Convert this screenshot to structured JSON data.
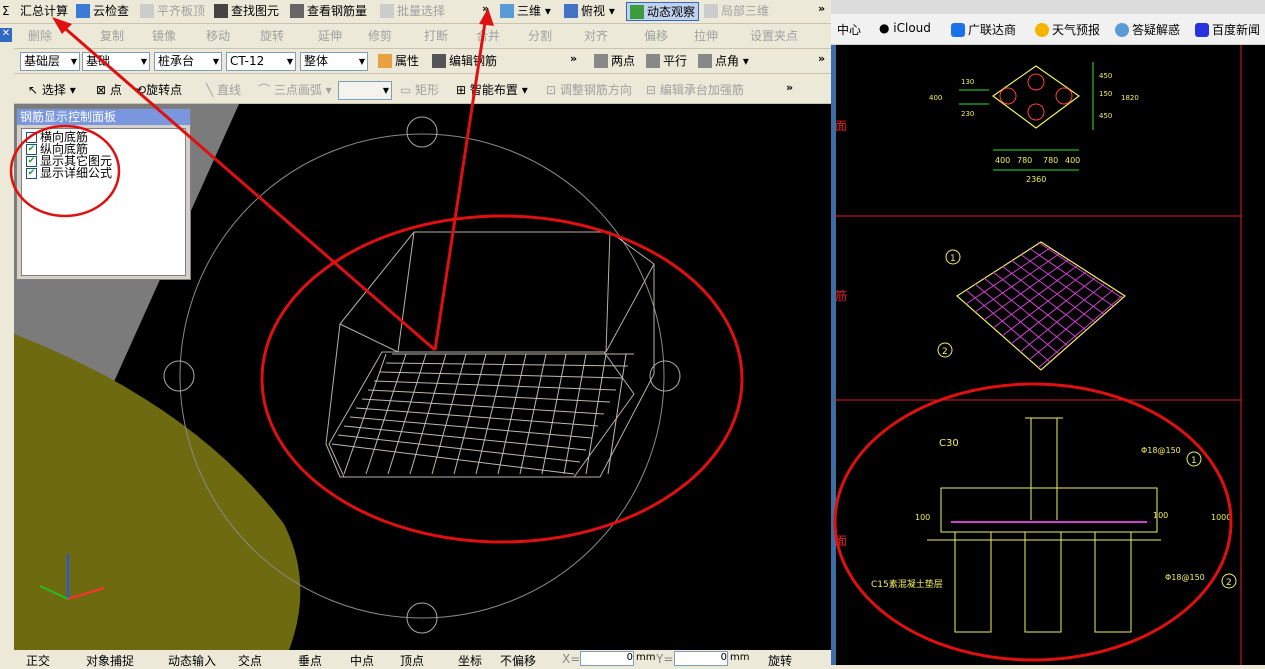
{
  "toolbar1": {
    "items": [
      "汇总计算",
      "云检查",
      "平齐板顶",
      "查找图元",
      "查看钢筋量",
      "批量选择"
    ],
    "view3d": "三维",
    "view_top": "俯视",
    "dynamic": "动态观察",
    "local3d": "局部三维"
  },
  "toolbar2": {
    "items": [
      "删除",
      "复制",
      "镜像",
      "移动",
      "旋转",
      "延伸",
      "修剪",
      "打断",
      "合并",
      "分割",
      "对齐",
      "偏移",
      "拉伸",
      "设置夹点"
    ]
  },
  "toolbar3": {
    "floor": "基础层",
    "category": "基础",
    "type": "桩承台",
    "component": "CT-12",
    "mode": "整体",
    "properties": "属性",
    "edit_rebar": "编辑钢筋",
    "two_points": "两点",
    "parallel": "平行",
    "point_angle": "点角"
  },
  "toolbar4": {
    "select": "选择",
    "point": "点",
    "rotate_point": "旋转点",
    "line": "直线",
    "arc": "三点画弧",
    "rect": "矩形",
    "smart": "智能布置",
    "adjust_dir": "调整钢筋方向",
    "edit_cap": "编辑承台加强筋"
  },
  "panel": {
    "title": "钢筋显示控制面板",
    "options": [
      {
        "label": "横向底筋",
        "checked": true
      },
      {
        "label": "纵向底筋",
        "checked": true
      },
      {
        "label": "显示其它图元",
        "checked": true
      },
      {
        "label": "显示详细公式",
        "checked": true
      }
    ]
  },
  "statusbar": {
    "items": [
      "正交",
      "对象捕捉",
      "动态输入",
      "交点",
      "垂点",
      "中点",
      "顶点",
      "坐标"
    ],
    "offset": "不偏移",
    "x_label": "X=",
    "x_value": "0",
    "y_label": "Y=",
    "y_value": "0",
    "unit": "mm",
    "rotate": "旋转"
  },
  "bookmarks": [
    "中心",
    "iCloud",
    "广联达商",
    "天气预报",
    "答疑解惑",
    "百度新闻"
  ],
  "cad": {
    "dims_top": [
      "400",
      "780",
      "780",
      "400"
    ],
    "total": "2360",
    "dims_right": [
      "450",
      "150",
      "450",
      "1820"
    ],
    "dims_left": [
      "130",
      "400",
      "230"
    ],
    "concrete": "C30",
    "rebar": "Φ18@150",
    "rebar2": "Φ18@150",
    "cover": "100",
    "cover2": "100",
    "depth": "1000",
    "c15": "C15素混凝土垫层",
    "marker1": "1",
    "marker2": "2",
    "side_labels": [
      "面",
      "筋",
      "面"
    ]
  }
}
